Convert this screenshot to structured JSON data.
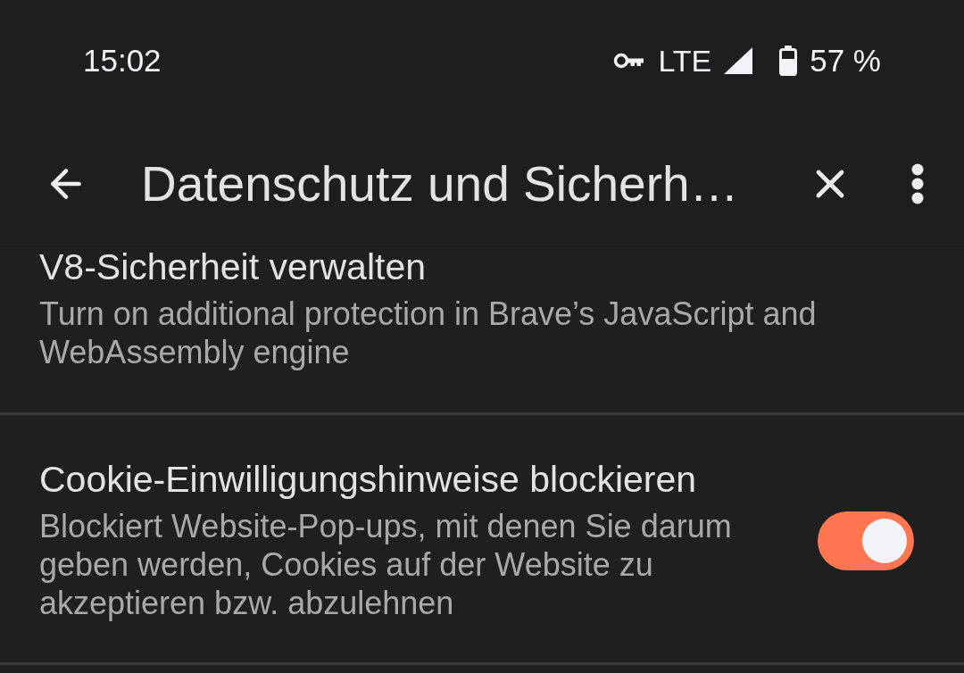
{
  "status_bar": {
    "time": "15:02",
    "network": "LTE",
    "battery": "57 %"
  },
  "toolbar": {
    "title": "Datenschutz und Sicherh…"
  },
  "settings": [
    {
      "kind": "text",
      "title": "V8-Sicherheit verwalten",
      "description": "Turn on additional protection in Brave’s JavaScript and WebAssembly engine"
    },
    {
      "kind": "toggle",
      "title": "Cookie-Einwilligungshinweise blockieren",
      "description": "Blockiert Website-Pop-ups, mit denen Sie darum geben werden, Cookies auf der Website zu akzeptieren bzw. abzulehnen",
      "on": true
    }
  ]
}
